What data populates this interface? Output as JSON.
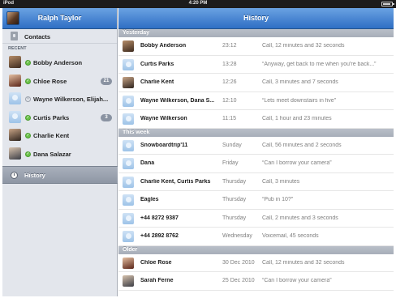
{
  "status_bar": {
    "carrier": "iPod",
    "time": "4:20 PM",
    "battery_level": 0.9
  },
  "sidebar": {
    "title": "Ralph Taylor",
    "contacts_label": "Contacts",
    "recent_caption": "RECENT",
    "items": [
      {
        "name": "Bobby Anderson",
        "status": "online",
        "avatar": "photo1",
        "badge": ""
      },
      {
        "name": "Chloe Rose",
        "status": "online",
        "avatar": "photo2",
        "badge": "21"
      },
      {
        "name": "Wayne Wilkerson, Elijah...",
        "status": "away",
        "avatar": "placeholder",
        "badge": ""
      },
      {
        "name": "Curtis Parks",
        "status": "online",
        "avatar": "placeholder",
        "badge": "3"
      },
      {
        "name": "Charlie Kent",
        "status": "online",
        "avatar": "photo3",
        "badge": ""
      },
      {
        "name": "Dana Salazar",
        "status": "online",
        "avatar": "photo4",
        "badge": ""
      }
    ],
    "history_label": "History"
  },
  "main": {
    "title": "History",
    "groups": [
      {
        "label": "Yesterday",
        "rows": [
          {
            "name": "Bobby Anderson",
            "when": "23:12",
            "detail": "Call, 12 minutes and 32 seconds",
            "avatar": "photo1"
          },
          {
            "name": "Curtis Parks",
            "when": "13:28",
            "detail": "“Anyway, get back to me when you're back...”",
            "avatar": "placeholder"
          },
          {
            "name": "Charlie Kent",
            "when": "12:26",
            "detail": "Call, 3 minutes and 7 seconds",
            "avatar": "photo3"
          },
          {
            "name": "Wayne Wilkerson, Dana S...",
            "when": "12:10",
            "detail": "“Lets meet downstairs in five”",
            "avatar": "placeholder"
          },
          {
            "name": "Wayne Wilkerson",
            "when": "11:15",
            "detail": "Call, 1 hour and 23 minutes",
            "avatar": "placeholder"
          }
        ]
      },
      {
        "label": "This week",
        "rows": [
          {
            "name": "Snowboardtrip'11",
            "when": "Sunday",
            "detail": "Call, 56 minutes and 2 seconds",
            "avatar": "placeholder"
          },
          {
            "name": "Dana",
            "when": "Friday",
            "detail": "“Can I borrow your camera”",
            "avatar": "placeholder"
          },
          {
            "name": "Charlie Kent, Curtis Parks",
            "when": "Thursday",
            "detail": "Call, 3 minutes",
            "avatar": "placeholder"
          },
          {
            "name": "Eagles",
            "when": "Thursday",
            "detail": "“Pub in 10?”",
            "avatar": "placeholder"
          },
          {
            "name": "+44 8272 9387",
            "when": "Thursday",
            "detail": "Call, 2 minutes and 3 seconds",
            "avatar": "placeholder"
          },
          {
            "name": "+44 2892 8762",
            "when": "Wednesday",
            "detail": "Voicemail, 45 seconds",
            "avatar": "placeholder"
          }
        ]
      },
      {
        "label": "Older",
        "rows": [
          {
            "name": "Chloe Rose",
            "when": "30 Dec 2010",
            "detail": "Call, 12 minutes and 32 seconds",
            "avatar": "photo2"
          },
          {
            "name": "Sarah Ferne",
            "when": "25 Dec 2010",
            "detail": "“Can I borrow your camera”",
            "avatar": "photo4"
          }
        ]
      }
    ]
  },
  "colors": {
    "header_blue": "#2f6fc4",
    "online_green": "#6cc24a",
    "badge_gray": "#8a93a2"
  }
}
